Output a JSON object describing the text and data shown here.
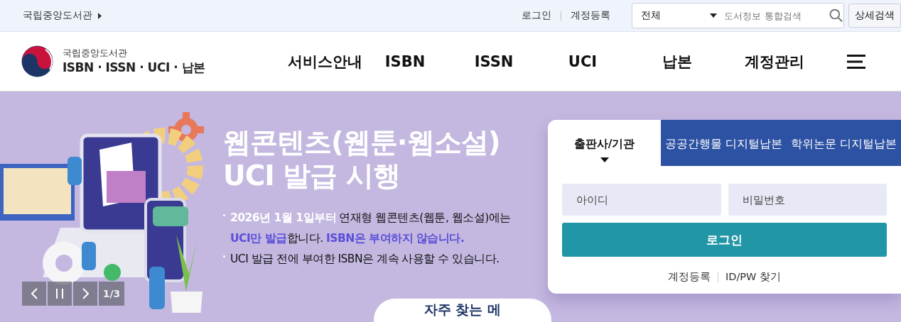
{
  "top_bar": {
    "site_link": "국립중앙도서관",
    "links": [
      "로그인",
      "계정등록"
    ],
    "search": {
      "scope": "전체",
      "placeholder": "도서정보 통합검색"
    },
    "advanced_button": "상세검색"
  },
  "header": {
    "logo": {
      "subtitle": "국립중앙도서관",
      "title": "ISBN · ISSN · UCI · 납본"
    },
    "nav": [
      "서비스안내",
      "ISBN",
      "ISSN",
      "UCI",
      "납본",
      "계정관리"
    ]
  },
  "banner": {
    "title_lines": [
      "웹콘텐츠(웹툰·웹소설)",
      "UCI 발급 시행"
    ],
    "bullets": [
      [
        {
          "kind": "white",
          "text": "2026년 1월 1일부터"
        },
        {
          "kind": "plain",
          "text": " 연재형 웹콘텐츠(웹툰, 웹소설)에는 "
        },
        {
          "kind": "purple",
          "text": "UCI만 발급"
        },
        {
          "kind": "plain",
          "text": "합니다. "
        },
        {
          "kind": "purple",
          "text": "ISBN은 부여하지 않습니다."
        }
      ],
      [
        {
          "kind": "plain",
          "text": "UCI 발급 전에 부여한 ISBN은 계속 사용할 수 있습니다."
        }
      ]
    ],
    "slider": {
      "counter": "1/3"
    },
    "quick_menu_button": "자주 찾는 메"
  },
  "login": {
    "tabs": [
      {
        "label": "출판사/기관",
        "selected": true
      },
      {
        "label": "공공간행물 디지털납본",
        "selected": false
      },
      {
        "label": "학위논문 디지털납본",
        "selected": false
      }
    ],
    "id_placeholder": "아이디",
    "password_placeholder": "비밀번호",
    "login_button": "로그인",
    "links": [
      "계정등록",
      "ID/PW 찾기"
    ]
  }
}
